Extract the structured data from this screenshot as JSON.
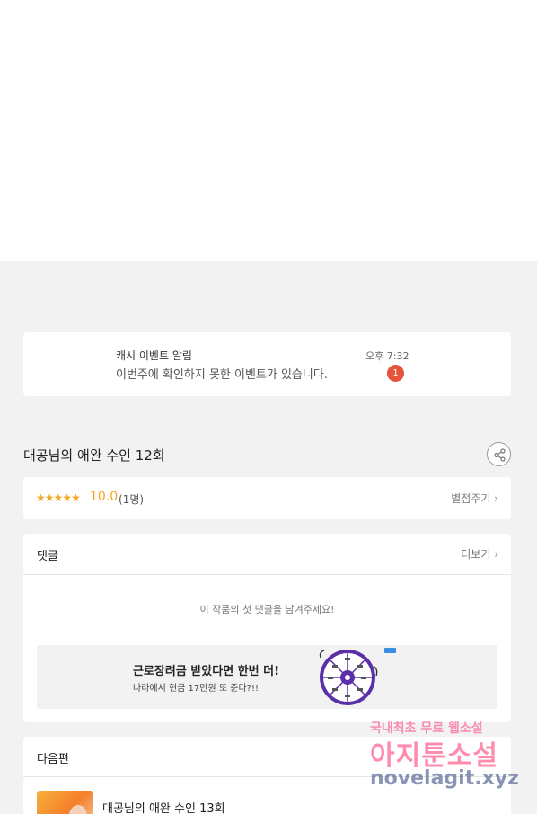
{
  "notification": {
    "title": "캐시 이벤트 알림",
    "message": "이번주에 확인하지 못한 이벤트가 있습니다.",
    "time": "오후 7:32",
    "badge": "1"
  },
  "episode": {
    "title": "대공님의 애완 수인 12회",
    "share_icon": "share-icon"
  },
  "rating": {
    "stars": "★★★★★",
    "score": "10.0",
    "count": "(1명)",
    "rate_link": "별점주기 ›",
    "star_color": "#f5a623"
  },
  "comments": {
    "header": "댓글",
    "more": "더보기 ›",
    "empty_message": "이 작품의 첫 댓글을 남겨주세요!"
  },
  "ad": {
    "headline": "근로장려금 받았다면 한번 더!",
    "subline": "나라에서 현금 17만원 또 준다?!!"
  },
  "next_episode": {
    "header": "다음편",
    "title": "대공님의 애완 수인 13회"
  },
  "watermark": {
    "line1": "국내최초 무료 웹소설",
    "line2": "아지툰소설",
    "line3": "novelagit.xyz"
  },
  "colors": {
    "badge": "#e4533a",
    "accent": "#f5a623",
    "wheel": "#5b2fa8"
  }
}
